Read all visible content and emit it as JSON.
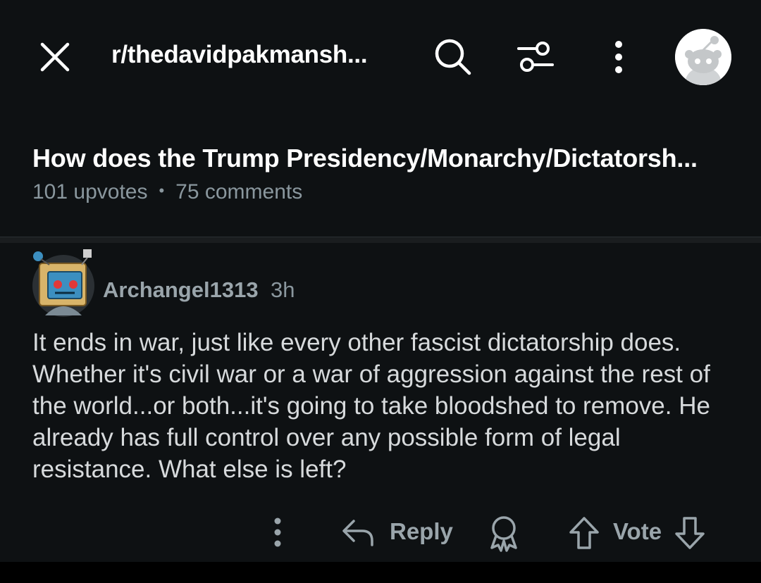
{
  "header": {
    "subreddit": "r/thedavidpakmansh...",
    "icons": [
      "close-icon",
      "search-icon",
      "filter-icon",
      "more-vertical-icon",
      "avatar-icon"
    ]
  },
  "post": {
    "title": "How does the Trump Presidency/Monarchy/Dictatorsh...",
    "upvotes": "101 upvotes",
    "separator": "•",
    "comments": "75 comments"
  },
  "comment": {
    "author": "Archangel1313",
    "time": "3h",
    "body": "It ends in war, just like every other fascist dictatorship does. Whether it's civil war or a war of aggression against the rest of the world...or both...it's going to take bloodshed to remove. He already has full control over any possible form of legal resistance. What else is left?"
  },
  "actions": {
    "reply_label": "Reply",
    "vote_label": "Vote",
    "icons": [
      "more-vertical-icon",
      "reply-icon",
      "award-icon",
      "upvote-icon",
      "downvote-icon"
    ]
  },
  "colors": {
    "background": "#0e1113",
    "text_primary": "#ffffff",
    "text_body": "#d7dadc",
    "text_muted": "#8a979e"
  }
}
